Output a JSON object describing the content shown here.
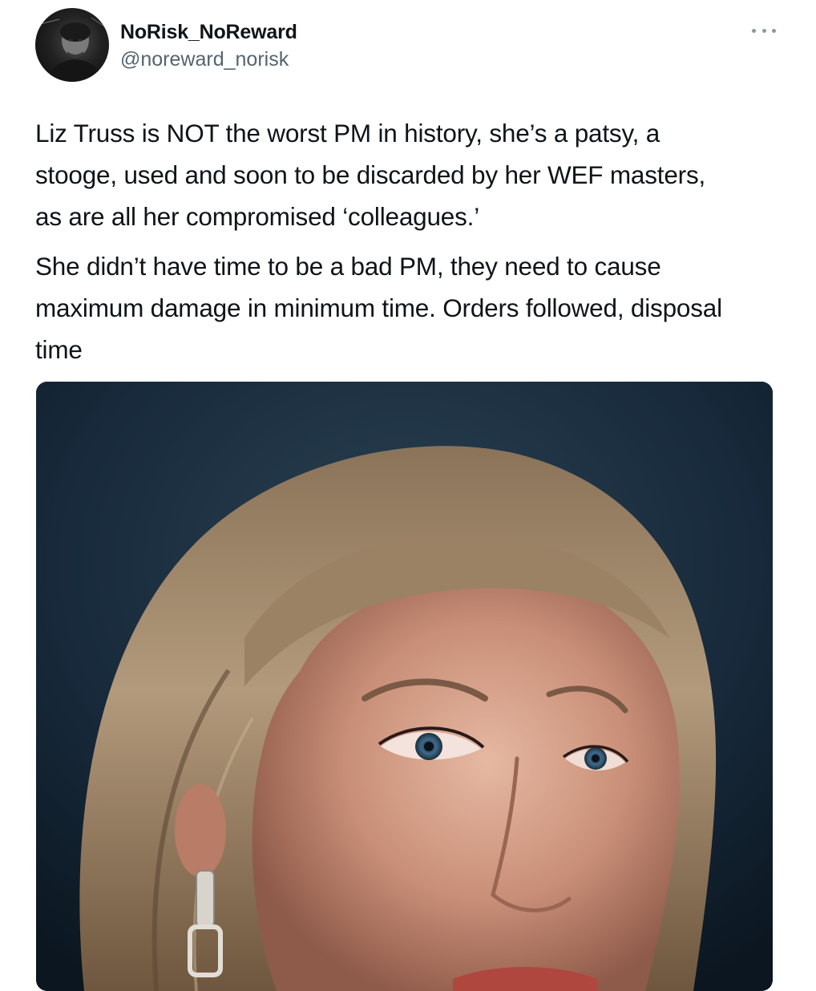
{
  "tweet": {
    "author": {
      "display_name": "NoRisk_NoReward",
      "handle": "@noreward_norisk"
    },
    "more_icon": "more-horizontal-icon",
    "paragraphs": [
      "Liz Truss is NOT the worst PM in history, she’s a patsy, a\nstooge, used and soon to be discarded by her WEF masters,\nas are all her compromised ‘colleagues.’",
      "She didn’t have time to be a bad PM, they need to cause\nmaximum damage in minimum time. Orders followed, disposal\ntime"
    ],
    "media": {
      "type": "photo"
    }
  },
  "colors": {
    "text": "#0f1419",
    "secondary_text": "#536471",
    "background": "#ffffff"
  }
}
